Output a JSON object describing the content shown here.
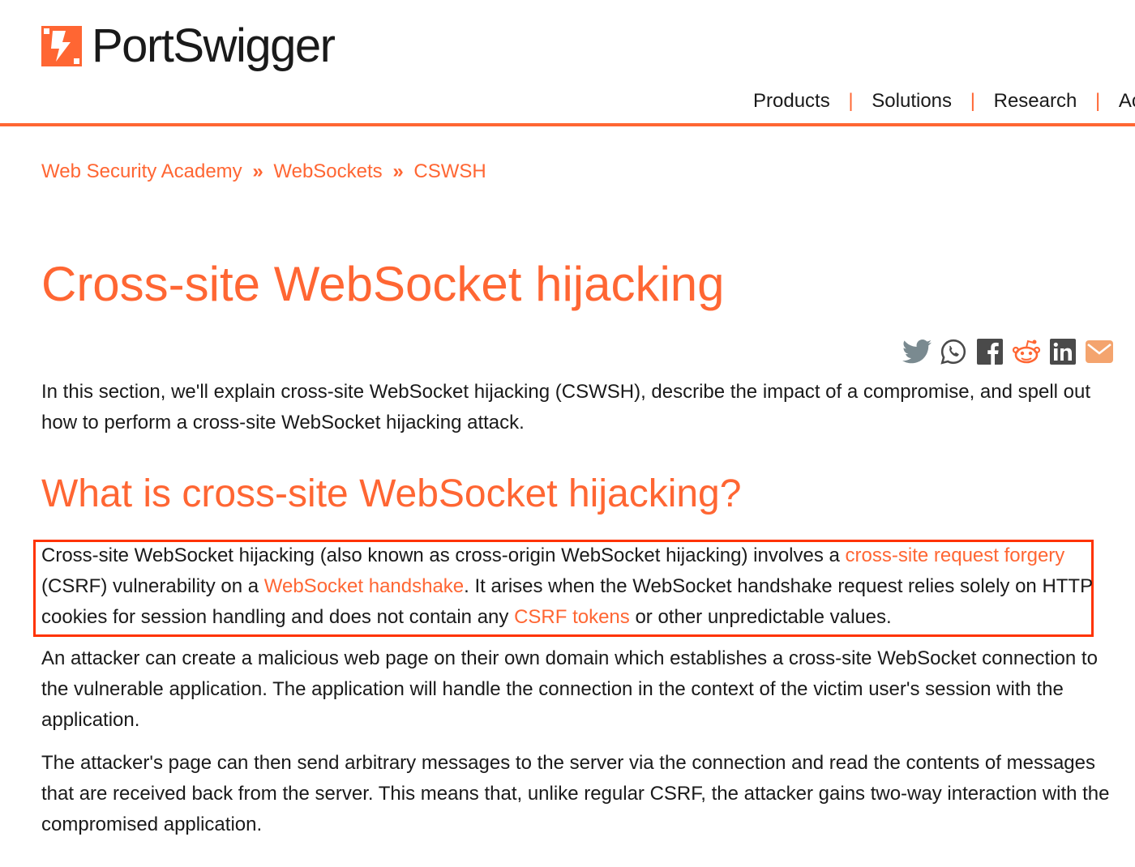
{
  "brand": {
    "name": "PortSwigger",
    "logo_icon": "portswigger-logo-icon",
    "accent_color": "#ff6633"
  },
  "nav": {
    "items": [
      "Products",
      "Solutions",
      "Research",
      "Aca"
    ],
    "separator": "|"
  },
  "breadcrumb": {
    "items": [
      "Web Security Academy",
      "WebSockets",
      "CSWSH"
    ],
    "separator": "»"
  },
  "title": "Cross-site WebSocket hijacking",
  "share_icons": [
    "twitter-icon",
    "whatsapp-icon",
    "facebook-icon",
    "reddit-icon",
    "linkedin-icon",
    "email-icon"
  ],
  "intro": "In this section, we'll explain cross-site WebSocket hijacking (CSWSH), describe the impact of a compromise, and spell out how to perform a cross-site WebSocket hijacking attack.",
  "section_heading": "What is cross-site WebSocket hijacking?",
  "definition": {
    "text1": "Cross-site WebSocket hijacking (also known as cross-origin WebSocket hijacking) involves a ",
    "link1": "cross-site request forgery",
    "text2": " (CSRF) vulnerability on a ",
    "link2": "WebSocket handshake",
    "text3": ". It arises when the WebSocket handshake request relies solely on HTTP cookies for session handling and does not contain any ",
    "link3": "CSRF tokens",
    "text4": " or other unpredictable values."
  },
  "attacker_para": "An attacker can create a malicious web page on their own domain which establishes a cross-site WebSocket connection to the vulnerable application. The application will handle the connection in the context of the victim user's session with the application.",
  "page_para": "The attacker's page can then send arbitrary messages to the server via the connection and read the contents of messages that are received back from the server. This means that, unlike regular CSRF, the attacker gains two-way interaction with the compromised application."
}
